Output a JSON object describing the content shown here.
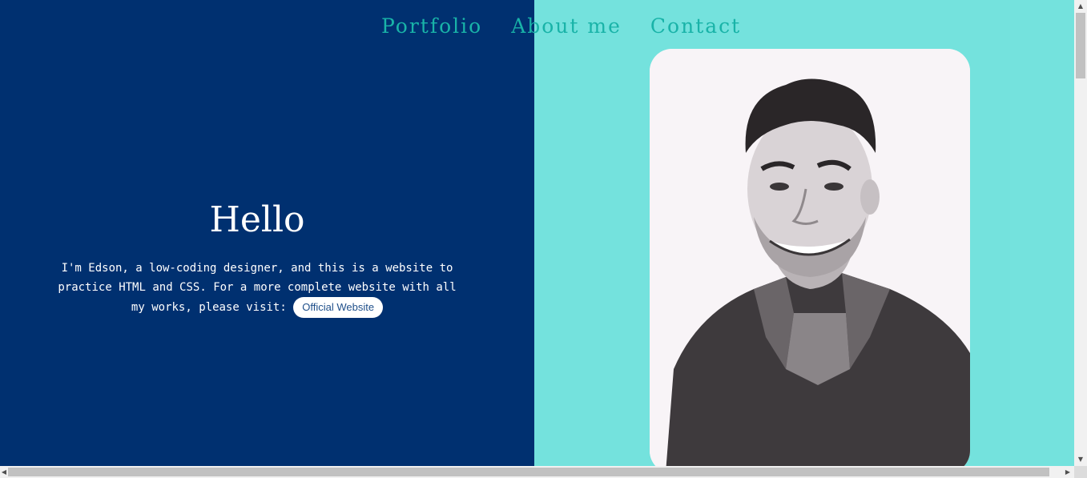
{
  "nav": {
    "items": [
      {
        "label": "Portfolio"
      },
      {
        "label": "About me"
      },
      {
        "label": "Contact"
      }
    ]
  },
  "hero": {
    "heading": "Hello",
    "intro_text": "I'm Edson, a low-coding designer, and this is a website to practice HTML and CSS. For a more complete website with all my works, please visit: ",
    "button_label": "Official Website"
  },
  "photo": {
    "description_icon": "portrait-photo"
  },
  "colors": {
    "left_panel": "#003070",
    "right_panel": "#74e2dd",
    "nav_link": "#19b3a8",
    "button_text": "#1f4f8a"
  },
  "scrollbars": {
    "up_arrow": "▲",
    "down_arrow": "▼",
    "left_arrow": "◀",
    "right_arrow": "▶"
  }
}
